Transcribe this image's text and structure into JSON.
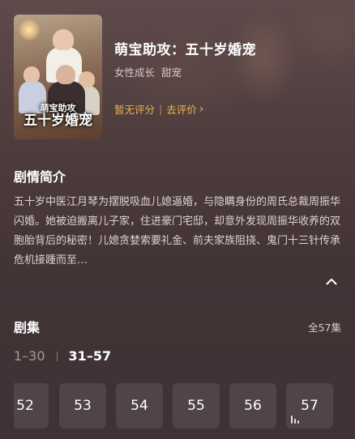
{
  "drama": {
    "title": "萌宝助攻：五十岁婚宠",
    "tags": [
      "女性成长",
      "甜宠"
    ],
    "poster_title_line1": "萌宝助攻",
    "poster_title_line2": "五十岁婚宠",
    "rating_text": "暂无评分",
    "rate_link": "去评价",
    "chevron_glyph": "›"
  },
  "synopsis": {
    "heading": "剧情简介",
    "text": "五十岁中医江月琴为摆脱吸血儿媳逼婚，与隐瞒身份的周氏总裁周振华闪婚。她被迫搬离儿子家，住进豪门宅邸，却意外发现周振华收养的双胞胎背后的秘密！儿媳贪婪索要礼金、前夫家族阻挠、鬼门十三针传承危机接踵而至…"
  },
  "episodes": {
    "heading": "剧集",
    "total": "全57集",
    "ranges": [
      {
        "label": "1–30",
        "active": false
      },
      {
        "label": "31–57",
        "active": true
      }
    ],
    "visible": [
      "52",
      "53",
      "54",
      "55",
      "56",
      "57"
    ],
    "playing": "57"
  },
  "colors": {
    "accent": "#e8b450",
    "background": "#4a3a3b"
  }
}
